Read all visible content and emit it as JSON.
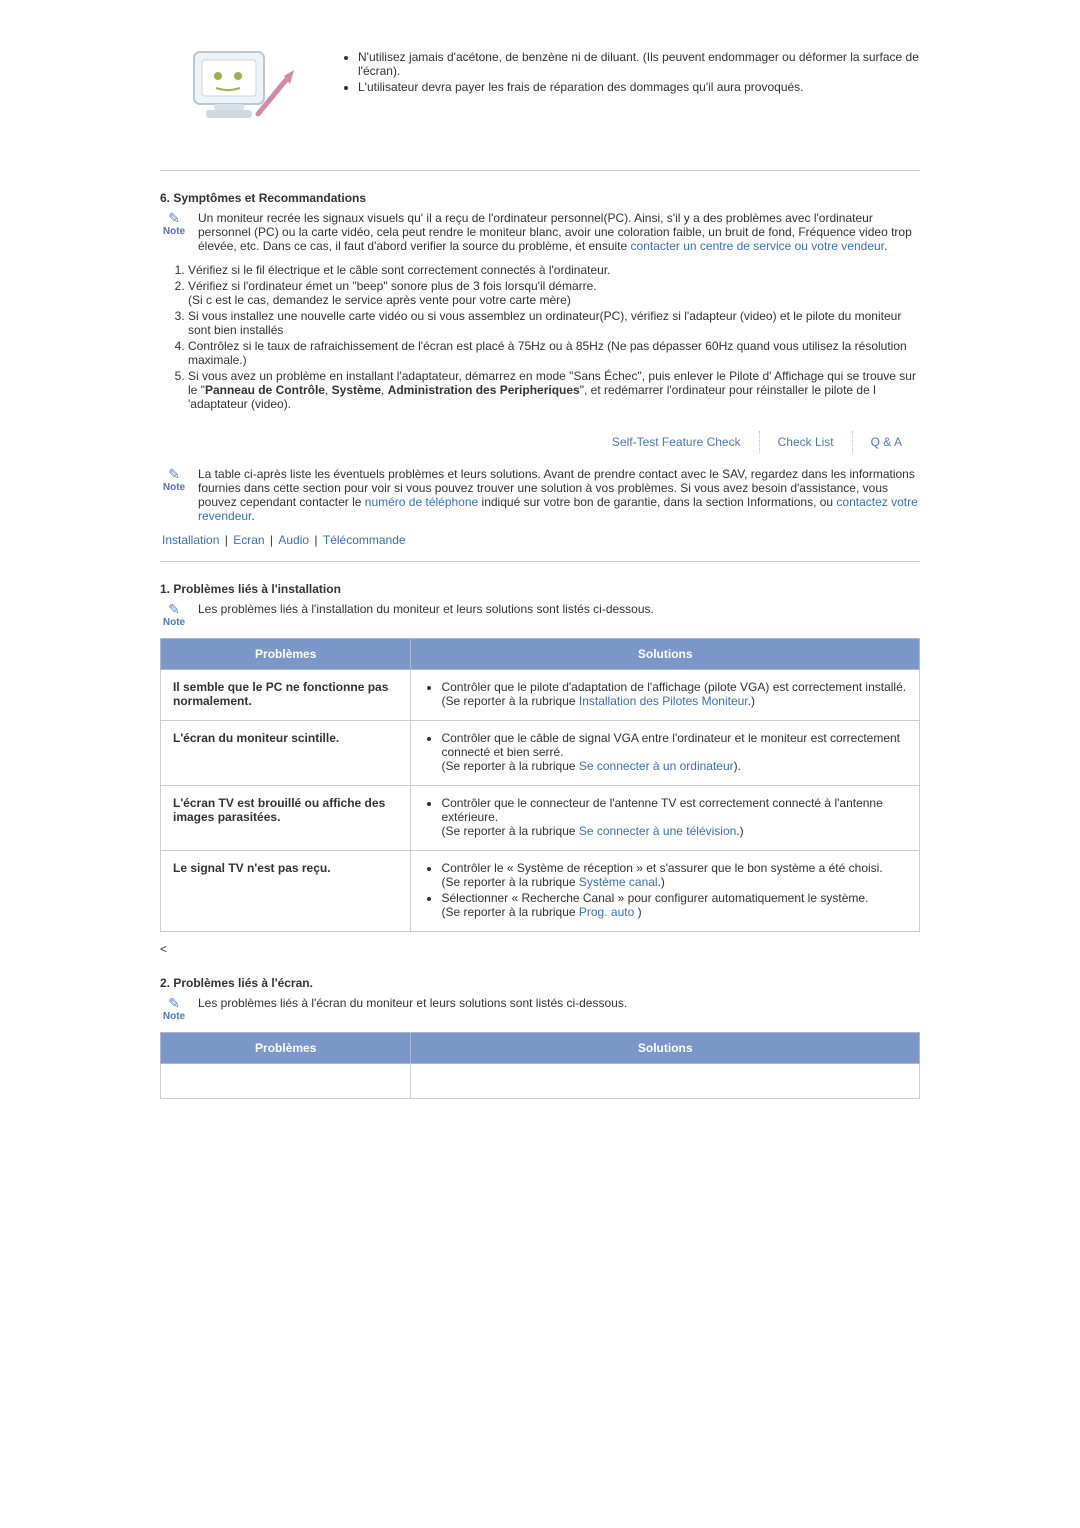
{
  "top_bullets": [
    "N'utilisez jamais d'acétone, de benzène ni de diluant. (Ils peuvent endommager ou déformer la surface de l'écran).",
    "L'utilisateur devra payer les frais de réparation des dommages qu'il aura provoqués."
  ],
  "section6": {
    "heading": "6. Symptômes et Recommandations",
    "note_before": "Un moniteur recrée les signaux visuels qu' il a reçu de l'ordinateur personnel(PC). Ainsi, s'il y a des problèmes avec l'ordinateur personnel (PC) ou la carte vidéo, cela peut rendre le moniteur blanc, avoir une coloration faible, un bruit de fond, Fréquence video trop élevée, etc. Dans ce cas, il faut d'abord verifier la source du problème, et ensuite ",
    "note_link": "contacter un centre de service ou votre vendeur",
    "note_after": ".",
    "list_items": [
      {
        "text": "Vérifiez si le fil électrique et le câble sont correctement connectés à l'ordinateur."
      },
      {
        "text": "Vérifiez si l'ordinateur émet un \"beep\" sonore plus de 3 fois lorsqu'il démarre.",
        "sub": "(Si c est le cas, demandez le service après vente pour votre carte mère)"
      },
      {
        "text": "Si vous installez une nouvelle carte vidéo ou si vous assemblez un ordinateur(PC), vérifiez si l'adapteur (video) et le pilote du moniteur sont bien installés"
      },
      {
        "text": "Contrôlez si le taux de rafraichissement de l'écran est placé à 75Hz ou à 85Hz (Ne pas dépasser 60Hz quand vous utilisez la résolution maximale.)"
      },
      {
        "html": "Si vous avez un problème en installant l'adaptateur, démarrez en mode \"Sans Échec\", puis enlever le Pilote d' Affichage qui se trouve sur le \"<b>Panneau de Contrôle</b>, <b>Système</b>, <b>Administration des Peripheriques</b>\", et redémarrer l'ordinateur pour réinstaller le pilote de l 'adaptateur (video)."
      }
    ]
  },
  "tabs": {
    "t1": "Self-Test Feature Check",
    "t2": "Check List",
    "t3": "Q & A"
  },
  "checklist_note": {
    "p1": "La table ci-après liste les éventuels problèmes et leurs solutions. Avant de prendre contact avec le SAV, regardez dans les informations fournies dans cette section pour voir si vous pouvez trouver une solution à vos problèmes. Si vous avez besoin d'assistance, vous pouvez cependant contacter le ",
    "link1": "numéro de téléphone",
    "p2": " indiqué sur votre bon de garantie, dans la section Informations, ou ",
    "link2": "contactez votre revendeur",
    "p3": "."
  },
  "pipe_links": {
    "l1": "Installation",
    "l2": "Ecran",
    "l3": "Audio",
    "l4": "Télécommande"
  },
  "sec_install": {
    "heading": "1. Problèmes liés à l'installation",
    "note": "Les problèmes liés à l'installation du moniteur et leurs solutions sont listés ci-dessous."
  },
  "table_headers": {
    "problems": "Problèmes",
    "solutions": "Solutions"
  },
  "table1": {
    "r1": {
      "p": "Il semble que le PC ne fonctionne pas normalement.",
      "s_before": "Contrôler que le pilote d'adaptation de l'affichage (pilote VGA) est correctement installé.\n(Se reporter à la rubrique ",
      "s_link": "Installation des Pilotes Moniteur",
      "s_after": ".)"
    },
    "r2": {
      "p": "L'écran du moniteur scintille.",
      "s_before": "Contrôler que le câble de signal VGA entre l'ordinateur et le moniteur est correctement connecté et bien serré.\n(Se reporter à la rubrique ",
      "s_link": "Se connecter à un ordinateur",
      "s_after": ")."
    },
    "r3": {
      "p": "L'écran TV est brouillé ou affiche des images parasitées.",
      "s_before": "Contrôler que le connecteur de l'antenne TV est correctement connecté à l'antenne extérieure.\n(Se reporter à la rubrique ",
      "s_link": "Se connecter à une télévision",
      "s_after": ".)"
    },
    "r4": {
      "p": "Le signal TV n'est pas reçu.",
      "b1_before": "Contrôler le « Système de réception » et s'assurer que le bon système a été choisi.\n(Se reporter à la rubrique ",
      "b1_link": "Système canal",
      "b1_after": ".)",
      "b2_before": "Sélectionner « Recherche Canal » pour configurer automatiquement le système.\n(Se reporter à la rubrique ",
      "b2_link": "Prog. auto",
      "b2_after": " )"
    }
  },
  "angle_bracket": "<",
  "sec_screen": {
    "heading": "2. Problèmes liés à l'écran.",
    "note": "Les problèmes liés à l'écran du moniteur et leurs solutions sont listés ci-dessous."
  }
}
